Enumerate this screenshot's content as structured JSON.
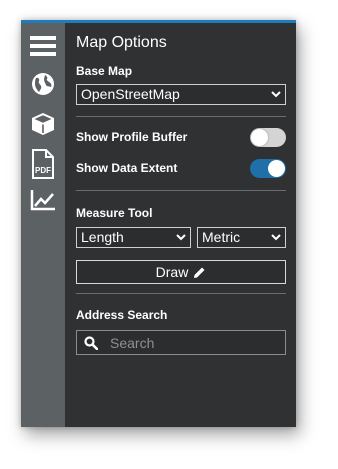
{
  "panel": {
    "title": "Map Options",
    "accent_color": "#1f7dbf"
  },
  "rail": {
    "items": [
      {
        "icon": "hamburger-menu-icon"
      },
      {
        "icon": "globe-icon"
      },
      {
        "icon": "cube-icon"
      },
      {
        "icon": "pdf-file-icon"
      },
      {
        "icon": "line-chart-icon"
      }
    ]
  },
  "base_map": {
    "label": "Base Map",
    "selected": "OpenStreetMap"
  },
  "toggles": {
    "profile_buffer": {
      "label": "Show Profile Buffer",
      "on": false
    },
    "data_extent": {
      "label": "Show Data Extent",
      "on": true,
      "on_color": "#1f6fa8"
    }
  },
  "measure": {
    "label": "Measure Tool",
    "mode_selected": "Length",
    "units_selected": "Metric",
    "draw_label": "Draw"
  },
  "address_search": {
    "label": "Address Search",
    "placeholder": "Search"
  }
}
